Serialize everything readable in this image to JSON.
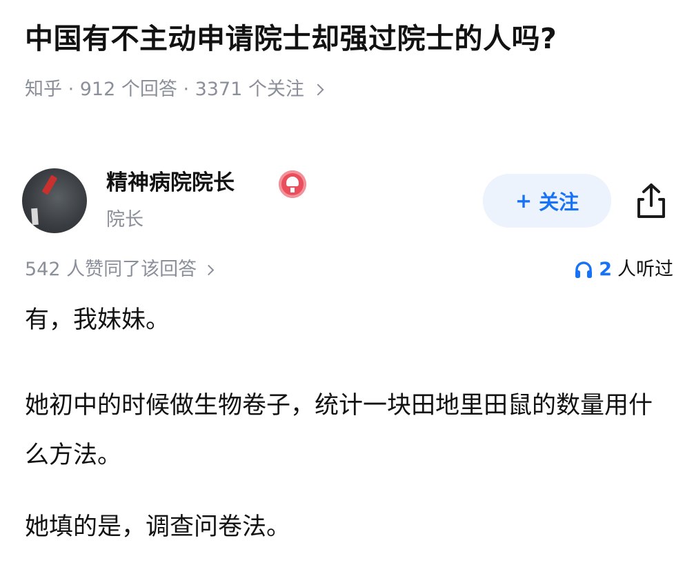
{
  "question": {
    "title": "中国有不主动申请院士却强过院士的人吗?",
    "meta": "知乎 · 912 个回答 · 3371 个关注"
  },
  "author": {
    "name": "精神病院院长",
    "title": "院长",
    "badge_icon": "verified-badge-icon",
    "badge_color": "#ea4d5c"
  },
  "actions": {
    "follow_plus": "+",
    "follow_label": "关注",
    "follow_color": "#1772f6",
    "share_icon": "share-icon"
  },
  "stats": {
    "votes": "542 人赞同了该回答",
    "listen_count": "2",
    "listen_label": "人听过",
    "listen_icon": "headphones-icon"
  },
  "answer": {
    "paragraphs": [
      "有，我妹妹。",
      "她初中的时候做生物卷子，统计一块田地里田鼠的数量用什么方法。",
      "她填的是，调查问卷法。"
    ]
  }
}
